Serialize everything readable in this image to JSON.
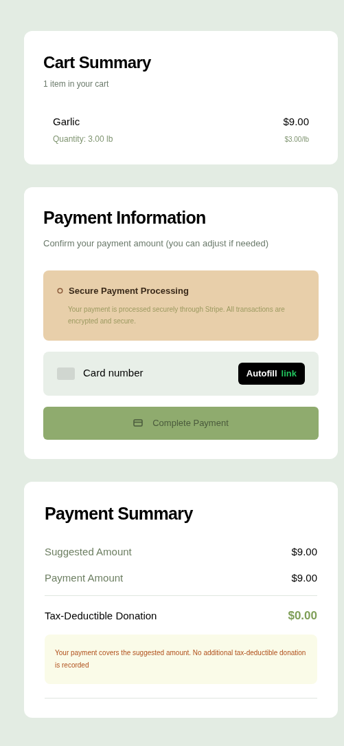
{
  "cart": {
    "title": "Cart Summary",
    "subtitle": "1 item in your cart",
    "items": [
      {
        "name": "Garlic",
        "quantity": "Quantity: 3.00 lb",
        "price": "$9.00",
        "unit_price": "$3.00/lb"
      }
    ]
  },
  "payment": {
    "title": "Payment Information",
    "subtitle": "Confirm your payment amount (you can adjust if needed)",
    "notice": {
      "title": "Secure Payment Processing",
      "text": "Your payment is processed securely through Stripe. All transactions are encrypted and secure."
    },
    "card_field": {
      "placeholder": "Card number",
      "autofill": "Autofill",
      "link": "link"
    },
    "submit": {
      "label": "Complete Payment",
      "disabled": true
    }
  },
  "summary": {
    "title": "Payment Summary",
    "rows": [
      {
        "label": "Suggested Amount",
        "value": "$9.00",
        "kind": "plain"
      },
      {
        "label": "Payment Amount",
        "value": "$9.00",
        "kind": "plain"
      },
      {
        "label": "Tax-Deductible Donation",
        "value": "$0.00",
        "kind": "total"
      }
    ],
    "note": "Your payment covers the suggested amount. No additional tax-deductible donation is recorded"
  }
}
